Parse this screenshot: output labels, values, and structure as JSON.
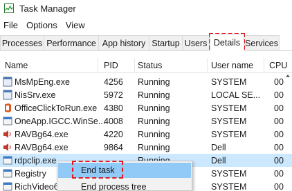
{
  "window": {
    "title": "Task Manager"
  },
  "menu": [
    "File",
    "Options",
    "View"
  ],
  "tabs": [
    "Processes",
    "Performance",
    "App history",
    "Startup",
    "Users",
    "Details",
    "Services"
  ],
  "active_tab": "Details",
  "columns": {
    "name": "Name",
    "pid": "PID",
    "status": "Status",
    "user": "User name",
    "cpu": "CPU"
  },
  "processes": [
    {
      "name": "MsMpEng.exe",
      "pid": "4256",
      "status": "Running",
      "user": "SYSTEM",
      "cpu": "00",
      "icon": "defender-app-icon"
    },
    {
      "name": "NisSrv.exe",
      "pid": "5972",
      "status": "Running",
      "user": "LOCAL SE...",
      "cpu": "00",
      "icon": "defender-app-icon"
    },
    {
      "name": "OfficeClickToRun.exe",
      "pid": "4380",
      "status": "Running",
      "user": "SYSTEM",
      "cpu": "00",
      "icon": "office-icon"
    },
    {
      "name": "OneApp.IGCC.WinSe...",
      "pid": "4008",
      "status": "Running",
      "user": "SYSTEM",
      "cpu": "00",
      "icon": "app-window-icon"
    },
    {
      "name": "RAVBg64.exe",
      "pid": "4220",
      "status": "Running",
      "user": "SYSTEM",
      "cpu": "00",
      "icon": "speaker-icon"
    },
    {
      "name": "RAVBg64.exe",
      "pid": "9864",
      "status": "Running",
      "user": "Dell",
      "cpu": "00",
      "icon": "speaker-icon"
    },
    {
      "name": "rdpclip.exe",
      "pid": "",
      "status": "Running",
      "user": "Dell",
      "cpu": "00",
      "icon": "app-window-icon"
    },
    {
      "name": "Registry",
      "pid": "",
      "status": "",
      "user": "SYSTEM",
      "cpu": "00",
      "icon": "app-window-icon"
    },
    {
      "name": "RichVideo64",
      "pid": "",
      "status": "",
      "user": "SYSTEM",
      "cpu": "00",
      "icon": "app-window-icon"
    }
  ],
  "context_menu": {
    "items": [
      "End task",
      "End process tree"
    ]
  },
  "colors": {
    "highlight_dashed": "#e0191f",
    "selected_row": "#cce8ff",
    "menu_hover": "#91c9f7"
  }
}
